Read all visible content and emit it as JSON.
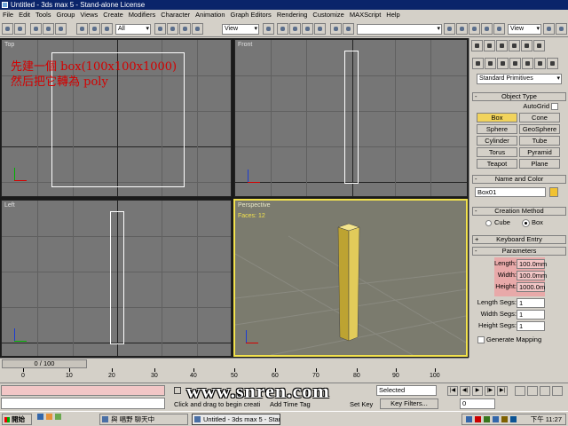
{
  "window": {
    "title": "Untitled - 3ds max 5 - Stand-alone License"
  },
  "menu": [
    "File",
    "Edit",
    "Tools",
    "Group",
    "Views",
    "Create",
    "Modifiers",
    "Character",
    "Animation",
    "Graph Editors",
    "Rendering",
    "Customize",
    "MAXScript",
    "Help"
  ],
  "toolbar": {
    "filter_value": "All",
    "coord_value": "View",
    "coord_value_2": "View"
  },
  "viewports": {
    "top": {
      "label": "Top"
    },
    "front": {
      "label": "Front"
    },
    "left": {
      "label": "Left"
    },
    "perspective": {
      "label": "Perspective",
      "faces": "Faces: 12"
    }
  },
  "annotation": {
    "line1": "先建一個 box(100x100x1000)",
    "line2": "然后把它轉為 poly"
  },
  "command_panel": {
    "category": "Standard Primitives",
    "object_type": {
      "header": "Object Type",
      "autogrid": "AutoGrid",
      "buttons": [
        "Box",
        "Cone",
        "Sphere",
        "GeoSphere",
        "Cylinder",
        "Tube",
        "Torus",
        "Pyramid",
        "Teapot",
        "Plane"
      ],
      "selected": "Box"
    },
    "name_color": {
      "header": "Name and Color",
      "name": "Box01",
      "color": "#f1c232"
    },
    "creation_method": {
      "header": "Creation Method",
      "options": [
        "Cube",
        "Box"
      ],
      "selected": "Box"
    },
    "keyboard_entry": {
      "header": "Keyboard Entry"
    },
    "parameters": {
      "header": "Parameters",
      "length_label": "Length:",
      "length": "100.0mm",
      "width_label": "Width:",
      "width": "100.0mm",
      "height_label": "Height:",
      "height": "1000.0m",
      "length_segs_label": "Length Segs:",
      "length_segs": "1",
      "width_segs_label": "Width Segs:",
      "width_segs": "1",
      "height_segs_label": "Height Segs:",
      "height_segs": "1",
      "gen_mapping": "Generate Mapping"
    }
  },
  "timeline": {
    "slider": "0 / 100",
    "ticks": [
      "0",
      "10",
      "20",
      "30",
      "40",
      "50",
      "60",
      "70",
      "80",
      "90",
      "100"
    ]
  },
  "status": {
    "prompt": "Click and drag to begin creati",
    "add_time_tag": "Add Time Tag",
    "set_key": "Set Key",
    "key_filters": "Key Filters...",
    "selected": "Selected",
    "frame": "0"
  },
  "watermark": "www.snren.com",
  "taskbar": {
    "start": "開始",
    "item1": "與 唱野 聊天中",
    "item2": "Untitled - 3ds max 5 - Stan...",
    "clock": "下午 11:27"
  }
}
